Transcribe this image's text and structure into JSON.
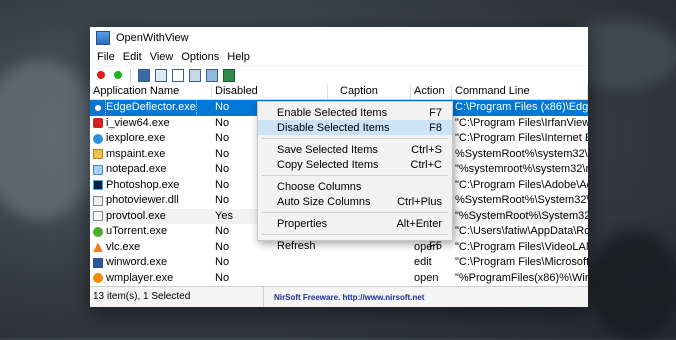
{
  "window": {
    "title": "OpenWithView",
    "menu": [
      "File",
      "Edit",
      "View",
      "Options",
      "Help"
    ],
    "toolbar_icons": [
      "disable-red-icon",
      "enable-green-icon",
      "save-icon",
      "copy-icon",
      "report-icon",
      "properties-icon",
      "refresh-icon",
      "exit-icon"
    ]
  },
  "columns": {
    "app": "Application Name",
    "disabled": "Disabled",
    "caption": "Caption",
    "action": "Action",
    "command": "Command Line"
  },
  "rows": [
    {
      "app": "EdgeDeflector.exe",
      "disabled": "No",
      "action": "",
      "command": "C:\\Program Files (x86)\\Edge",
      "icon": "edge-icon"
    },
    {
      "app": "i_view64.exe",
      "disabled": "No",
      "action": "",
      "command": "\"C:\\Program Files\\IrfanView\\",
      "icon": "irfanview-icon"
    },
    {
      "app": "iexplore.exe",
      "disabled": "No",
      "action": "",
      "command": "\"C:\\Program Files\\Internet E",
      "icon": "ie-icon"
    },
    {
      "app": "mspaint.exe",
      "disabled": "No",
      "action": "",
      "command": "%SystemRoot%\\system32\\m",
      "icon": "paint-icon"
    },
    {
      "app": "notepad.exe",
      "disabled": "No",
      "action": "",
      "command": "\"%systemroot%\\system32\\n",
      "icon": "notepad-icon"
    },
    {
      "app": "Photoshop.exe",
      "disabled": "No",
      "action": "",
      "command": "\"C:\\Program Files\\Adobe\\Ac",
      "icon": "photoshop-icon"
    },
    {
      "app": "photoviewer.dll",
      "disabled": "No",
      "action": "",
      "command": "%SystemRoot%\\System32\\r",
      "icon": "photoviewer-icon"
    },
    {
      "app": "provtool.exe",
      "disabled": "Yes",
      "action": "",
      "command": "\"%SystemRoot%\\System32\\",
      "icon": "provtool-icon"
    },
    {
      "app": "uTorrent.exe",
      "disabled": "No",
      "action": "",
      "command": "\"C:\\Users\\fatiw\\AppData\\Ro",
      "icon": "utorrent-icon"
    },
    {
      "app": "vlc.exe",
      "disabled": "No",
      "action": "open",
      "command": "\"C:\\Program Files\\VideoLAN",
      "icon": "vlc-icon"
    },
    {
      "app": "winword.exe",
      "disabled": "No",
      "action": "edit",
      "command": "\"C:\\Program Files\\Microsoft",
      "icon": "word-icon"
    },
    {
      "app": "wmplayer.exe",
      "disabled": "No",
      "action": "open",
      "command": "\"%ProgramFiles(x86)%\\Win",
      "icon": "wmplayer-icon"
    }
  ],
  "context_menu": [
    {
      "label": "Enable Selected Items",
      "key": "F7"
    },
    {
      "label": "Disable Selected Items",
      "key": "F8"
    },
    {
      "sep": true
    },
    {
      "label": "Save Selected Items",
      "key": "Ctrl+S"
    },
    {
      "label": "Copy Selected Items",
      "key": "Ctrl+C"
    },
    {
      "sep": true
    },
    {
      "label": "Choose Columns",
      "key": ""
    },
    {
      "label": "Auto Size Columns",
      "key": "Ctrl+Plus"
    },
    {
      "sep": true
    },
    {
      "label": "Properties",
      "key": "Alt+Enter"
    },
    {
      "sep": true
    },
    {
      "label": "Refresh",
      "key": "F5"
    }
  ],
  "status": {
    "count": "13 item(s), 1 Selected",
    "freeware": "NirSoft Freeware.  http://www.nirsoft.net"
  },
  "colors": {
    "selection": "#0078d7",
    "menu_hover": "#cce4f7",
    "link": "#1a2fa0"
  }
}
